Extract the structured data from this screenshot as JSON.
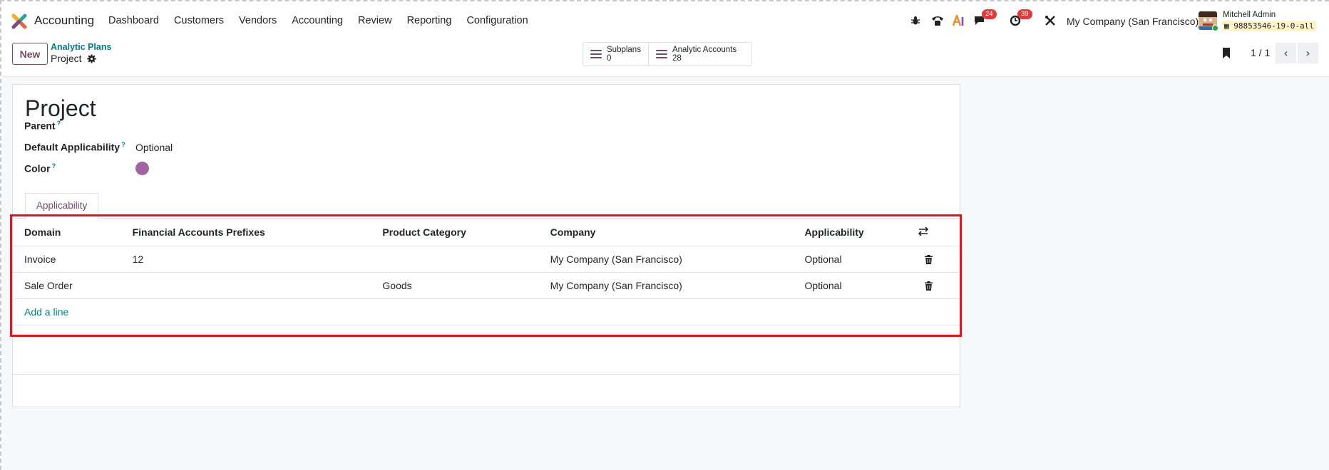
{
  "navbar": {
    "app_name": "Accounting",
    "menu": [
      "Dashboard",
      "Customers",
      "Vendors",
      "Accounting",
      "Review",
      "Reporting",
      "Configuration"
    ],
    "systray": {
      "debug_icon": "bug-icon",
      "phone_icon": "phone-icon",
      "ai_icon": "ai-icon",
      "messages_badge": "24",
      "activities_badge": "39",
      "tools_icon": "wrench-icon",
      "company": "My Company (San Francisco)",
      "user_name": "Mitchell Admin",
      "database": "98853546-19-0-all"
    }
  },
  "control_panel": {
    "new_label": "New",
    "breadcrumb_parent": "Analytic Plans",
    "breadcrumb_current": "Project",
    "smart_buttons": [
      {
        "label": "Subplans",
        "value": "0"
      },
      {
        "label": "Analytic Accounts",
        "value": "28"
      }
    ],
    "pager": "1 / 1"
  },
  "form": {
    "title": "Project",
    "fields": {
      "parent_label": "Parent",
      "default_applicability_label": "Default Applicability",
      "default_applicability_value": "Optional",
      "color_label": "Color",
      "color_value": "#a263a2"
    },
    "tab_label": "Applicability",
    "table": {
      "headers": [
        "Domain",
        "Financial Accounts Prefixes",
        "Product Category",
        "Company",
        "Applicability"
      ],
      "rows": [
        {
          "domain": "Invoice",
          "prefixes": "12",
          "product_category": "",
          "company": "My Company (San Francisco)",
          "applicability": "Optional"
        },
        {
          "domain": "Sale Order",
          "prefixes": "",
          "product_category": "Goods",
          "company": "My Company (San Francisco)",
          "applicability": "Optional"
        }
      ],
      "add_line_label": "Add a line"
    }
  },
  "colors": {
    "brand": "#714b67",
    "link": "#017e84",
    "highlight": "#e5131b"
  }
}
